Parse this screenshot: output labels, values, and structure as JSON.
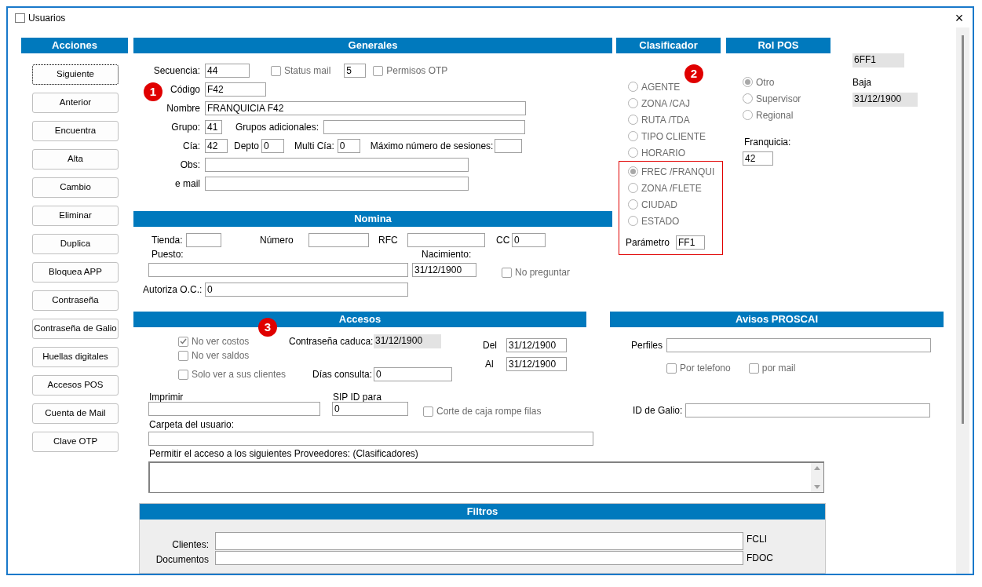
{
  "window": {
    "title": "Usuarios",
    "close": "×"
  },
  "acciones": {
    "title": "Acciones",
    "buttons": [
      {
        "label": "Siguiente",
        "focused": true
      },
      {
        "label": "Anterior",
        "focused": false
      },
      {
        "label": "Encuentra",
        "focused": false
      },
      {
        "label": "Alta",
        "focused": false
      },
      {
        "label": "Cambio",
        "focused": false
      },
      {
        "label": "Eliminar",
        "focused": false
      },
      {
        "label": "Duplica",
        "focused": false
      },
      {
        "label": "Bloquea APP",
        "focused": false
      },
      {
        "label": "Contraseña",
        "focused": false
      },
      {
        "label": "Contraseña de Galio",
        "focused": false
      },
      {
        "label": "Huellas digitales",
        "focused": false
      },
      {
        "label": "Accesos POS",
        "focused": false
      },
      {
        "label": "Cuenta de Mail",
        "focused": false
      },
      {
        "label": "Clave OTP",
        "focused": false
      }
    ]
  },
  "generales": {
    "title": "Generales",
    "marker": "1",
    "secuencia": {
      "label": "Secuencia:",
      "value": "44"
    },
    "status_mail": {
      "label": "Status mail",
      "checked": false,
      "disabled": true
    },
    "status_value": {
      "value": "5"
    },
    "permisos_otp": {
      "label": "Permisos OTP",
      "checked": false,
      "disabled": true
    },
    "codigo": {
      "label": "Código",
      "value": "F42"
    },
    "nombre": {
      "label": "Nombre",
      "value": "FRANQUICIA F42"
    },
    "grupo": {
      "label": "Grupo:",
      "value": "41"
    },
    "grupos_adicionales": {
      "label": "Grupos adicionales:"
    },
    "cia": {
      "label": "Cía:",
      "value": "42"
    },
    "depto": {
      "label": "Depto",
      "value": "0"
    },
    "multi_cia": {
      "label": "Multi Cía:",
      "value": "0"
    },
    "max_sesiones": {
      "label": "Máximo número de sesiones:"
    },
    "obs": {
      "label": "Obs:"
    },
    "email": {
      "label": "e mail"
    }
  },
  "nomina": {
    "title": "Nomina",
    "tienda": {
      "label": "Tienda:"
    },
    "numero": {
      "label": "Número"
    },
    "rfc": {
      "label": "RFC"
    },
    "cc": {
      "label": "CC",
      "value": "0"
    },
    "puesto": {
      "label": "Puesto:"
    },
    "nacimiento": {
      "label": "Nacimiento:",
      "value": "31/12/1900"
    },
    "no_preguntar": {
      "label": "No preguntar",
      "checked": false,
      "disabled": true
    },
    "autoriza": {
      "label": "Autoriza O.C.:",
      "value": "0"
    }
  },
  "clasificador": {
    "title": "Clasificador",
    "marker": "2",
    "disabled": true,
    "options": [
      {
        "label": "AGENTE",
        "selected": false
      },
      {
        "label": "ZONA /CAJ",
        "selected": false
      },
      {
        "label": "RUTA /TDA",
        "selected": false
      },
      {
        "label": "TIPO CLIENTE",
        "selected": false
      },
      {
        "label": "HORARIO",
        "selected": false
      }
    ],
    "highlighted": {
      "options": [
        {
          "label": "FREC /FRANQUI",
          "selected": true
        },
        {
          "label": "ZONA /FLETE",
          "selected": false
        },
        {
          "label": "CIUDAD",
          "selected": false
        },
        {
          "label": "ESTADO",
          "selected": false
        }
      ],
      "parametro": {
        "label": "Parámetro",
        "value": "FF1"
      }
    }
  },
  "rol_pos": {
    "title": "Rol POS",
    "disabled": true,
    "options": [
      {
        "label": "Otro",
        "selected": true
      },
      {
        "label": "Supervisor",
        "selected": false
      },
      {
        "label": "Regional",
        "selected": false
      }
    ],
    "franquicia": {
      "label": "Franquicia:",
      "value": "42"
    }
  },
  "info": {
    "code": {
      "value": "6FF1"
    },
    "baja": {
      "label": "Baja",
      "value": "31/12/1900"
    }
  },
  "accesos": {
    "title": "Accesos",
    "marker": "3",
    "checks": [
      {
        "label": "No ver costos",
        "checked": true,
        "disabled": true
      },
      {
        "label": "No ver saldos",
        "checked": false,
        "disabled": true
      },
      {
        "label": "Solo ver a sus clientes",
        "checked": false,
        "disabled": true
      }
    ],
    "contrasena_caduca": {
      "label": "Contraseña caduca:",
      "value": "31/12/1900"
    },
    "dias_consulta": {
      "label": "Días consulta:",
      "value": "0"
    },
    "del": {
      "label": "Del",
      "value": "31/12/1900"
    },
    "al": {
      "label": "Al",
      "value": "31/12/1900"
    },
    "imprimir": {
      "label": "Imprimir"
    },
    "sip_id": {
      "label": "SIP ID para",
      "value": "0"
    },
    "corte_caja": {
      "label": "Corte de caja rompe filas",
      "checked": false,
      "disabled": true
    },
    "carpeta": {
      "label": "Carpeta del usuario:"
    },
    "proveedores": {
      "label": "Permitir el acceso a los siguientes Proveedores: (Clasificadores)"
    }
  },
  "avisos": {
    "title": "Avisos PROSCAI",
    "perfiles": {
      "label": "Perfiles"
    },
    "checks": [
      {
        "label": "Por telefono",
        "checked": false,
        "disabled": true
      },
      {
        "label": "por mail",
        "checked": false,
        "disabled": true
      }
    ],
    "id_galio": {
      "label": "ID de Galio:"
    }
  },
  "filtros": {
    "title": "Filtros",
    "rows": [
      {
        "label": "Clientes:",
        "code": "FCLI"
      },
      {
        "label": "Documentos",
        "code": "FDOC"
      }
    ]
  }
}
